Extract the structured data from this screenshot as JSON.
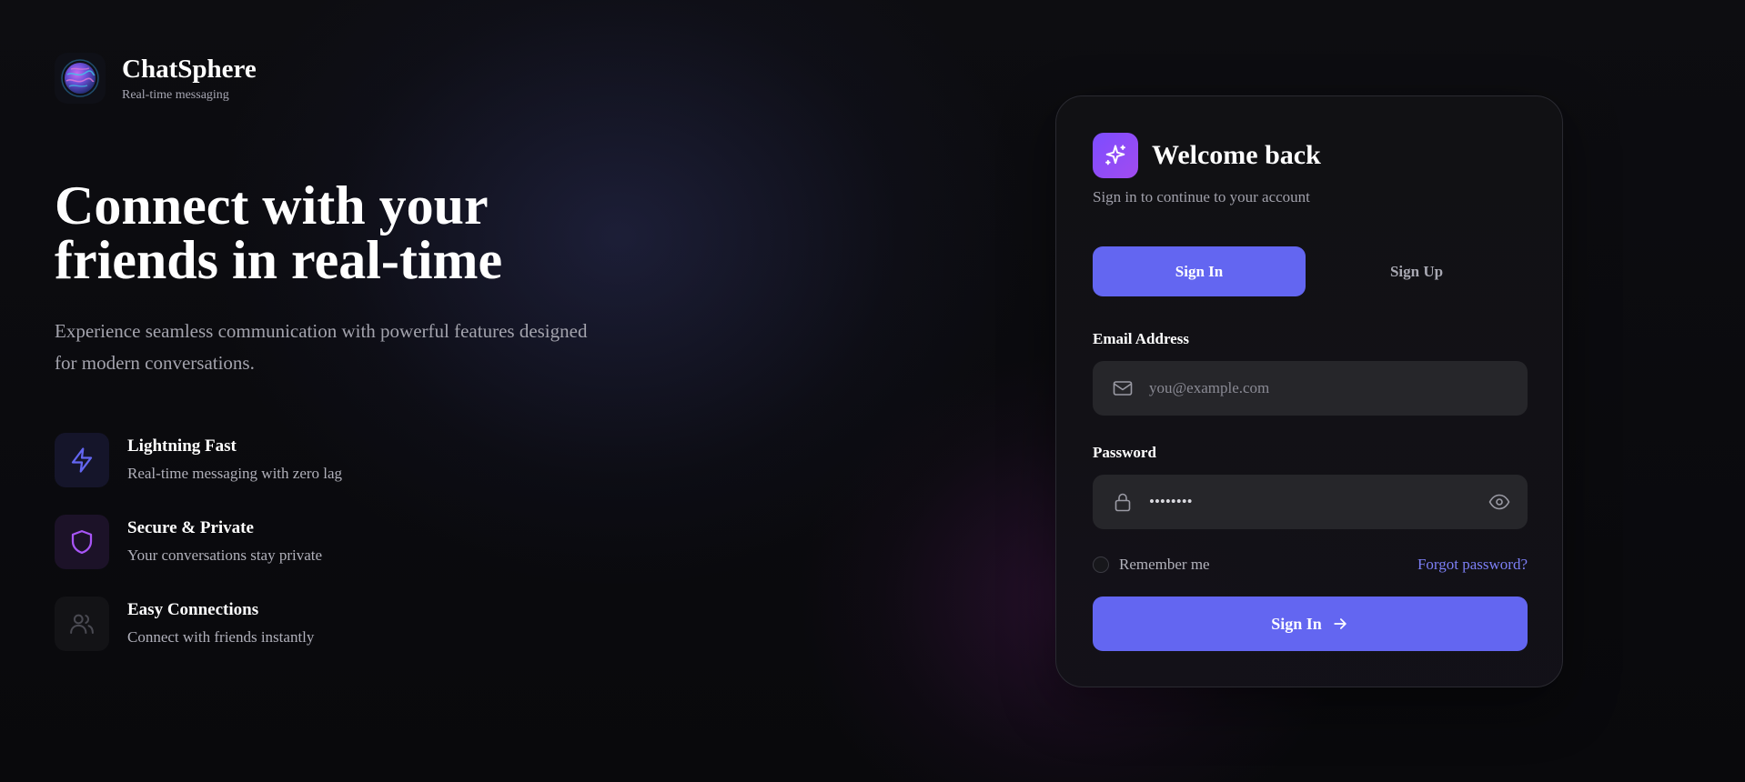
{
  "brand": {
    "name": "ChatSphere",
    "tagline": "Real-time messaging",
    "logo_icon": "globe-logo-icon"
  },
  "hero": {
    "title": "Connect with your\nfriends in real-time",
    "subtitle": "Experience seamless communication with powerful features designed for modern conversations."
  },
  "features": [
    {
      "icon": "lightning-icon",
      "title": "Lightning Fast",
      "desc": "Real-time messaging with zero lag",
      "color": "#6366f1"
    },
    {
      "icon": "shield-icon",
      "title": "Secure & Private",
      "desc": "Your conversations stay private",
      "color": "#a855f7"
    },
    {
      "icon": "users-icon",
      "title": "Easy Connections",
      "desc": "Connect with friends instantly",
      "color": "#52525b"
    }
  ],
  "auth": {
    "title": "Welcome back",
    "subtitle": "Sign in to continue to your account",
    "header_icon": "sparkles-icon",
    "tabs": [
      {
        "label": "Sign In",
        "active": true
      },
      {
        "label": "Sign Up",
        "active": false
      }
    ],
    "email": {
      "label": "Email Address",
      "placeholder": "you@example.com",
      "value": "",
      "icon": "mail-icon"
    },
    "password": {
      "label": "Password",
      "value": "••••••••",
      "icon": "lock-icon",
      "toggle_icon": "eye-icon"
    },
    "remember_label": "Remember me",
    "remember_checked": false,
    "forgot_label": "Forgot password?",
    "submit_label": "Sign In",
    "submit_icon": "arrow-right-icon"
  },
  "colors": {
    "accent": "#6366f1",
    "accent_purple": "#a855f7",
    "link": "#7c7ff5",
    "background": "#0b0b0e",
    "card": "#111114",
    "input": "#26262a"
  }
}
